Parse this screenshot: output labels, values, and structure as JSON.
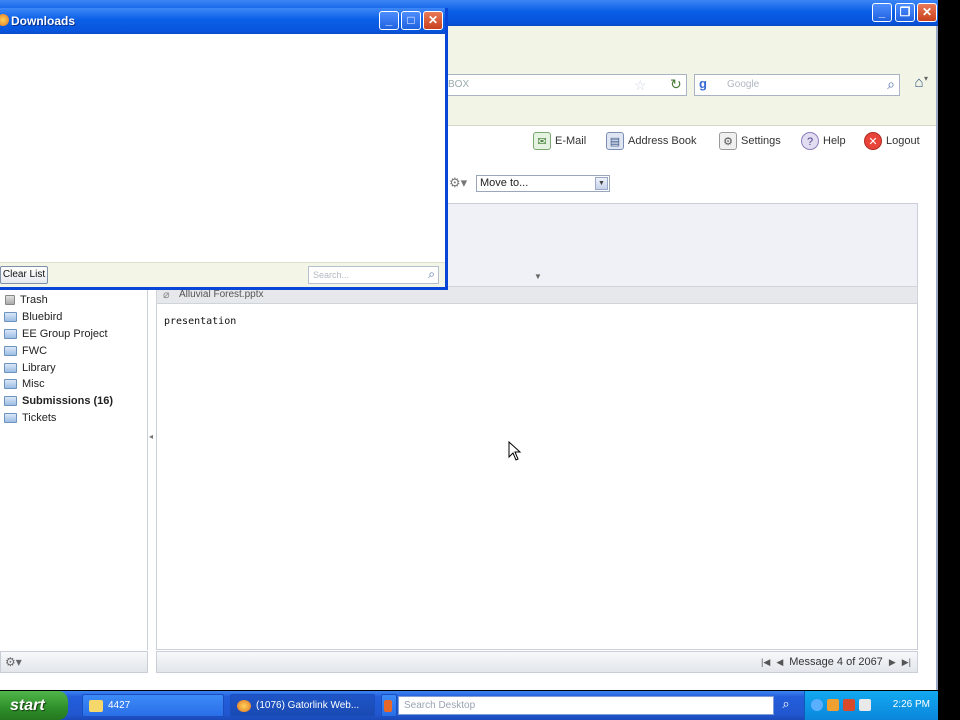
{
  "browser": {
    "url_fragment": "BOX",
    "search_placeholder": "Google",
    "window_controls": {
      "minimize": "_",
      "maximize": "❐",
      "close": "✕"
    }
  },
  "app_toolbar": {
    "email_label": "E-Mail",
    "address_book_label": "Address Book",
    "settings_label": "Settings",
    "help_label": "Help",
    "logout_label": "Logout",
    "move_to_value": "Move to..."
  },
  "message": {
    "attachment_name": "Alluvial Forest.pptx",
    "body_text": "presentation"
  },
  "folders": [
    {
      "label": "Trash",
      "bold": false
    },
    {
      "label": "Bluebird",
      "bold": false
    },
    {
      "label": "EE Group Project",
      "bold": false
    },
    {
      "label": "FWC",
      "bold": false
    },
    {
      "label": "Library",
      "bold": false
    },
    {
      "label": "Misc",
      "bold": false
    },
    {
      "label": "Submissions (16)",
      "bold": true
    },
    {
      "label": "Tickets",
      "bold": false
    }
  ],
  "pager": {
    "label": "Message 4 of 2067"
  },
  "downloads_window": {
    "title": "Downloads",
    "clear_list_label": "Clear List",
    "search_placeholder": "Search..."
  },
  "taskbar": {
    "start_label": "start",
    "task_folder_label": "4427",
    "task_browser_label": "(1076) Gatorlink Web...",
    "desktop_search_placeholder": "Search Desktop",
    "clock": "2:26 PM"
  },
  "colors": {
    "xp_blue_title": "#0a5ee6",
    "toolbar_bg": "#f2f5e5",
    "start_green": "#2e8f2a",
    "tray_blue": "#0b86db"
  }
}
